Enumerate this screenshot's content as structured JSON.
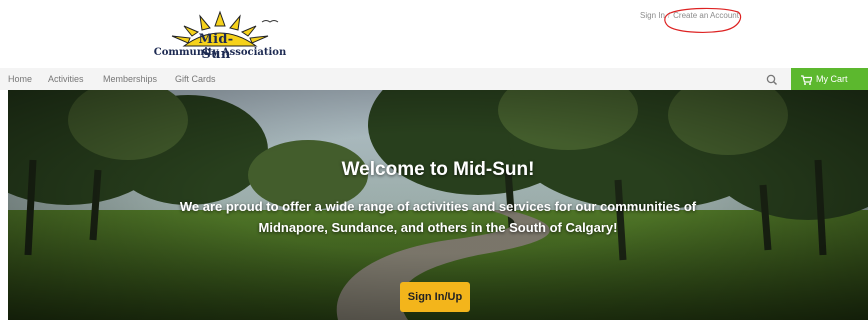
{
  "logo": {
    "line1": "Mid-Sun",
    "line2": "Community Association"
  },
  "account": {
    "sign_in": "Sign In",
    "separator": "/",
    "create": "Create an Account"
  },
  "nav": {
    "items": [
      {
        "label": "Home"
      },
      {
        "label": "Activities"
      },
      {
        "label": "Memberships"
      },
      {
        "label": "Gift Cards"
      }
    ]
  },
  "cart": {
    "label": "My Cart"
  },
  "hero": {
    "title": "Welcome to Mid-Sun!",
    "subtitle_line1": "We are proud to offer a wide range of activities and services for our communities of",
    "subtitle_line2": "Midnapore, Sundance, and others in the South of Calgary!",
    "cta": "Sign In/Up"
  },
  "colors": {
    "brand_green": "#5cb82e",
    "cta_yellow": "#f3b51b",
    "logo_navy": "#1d2a52",
    "annotation_red": "#d22"
  },
  "icons": {
    "search": "search-icon",
    "cart": "cart-icon",
    "sun": "sun-logo-icon"
  }
}
